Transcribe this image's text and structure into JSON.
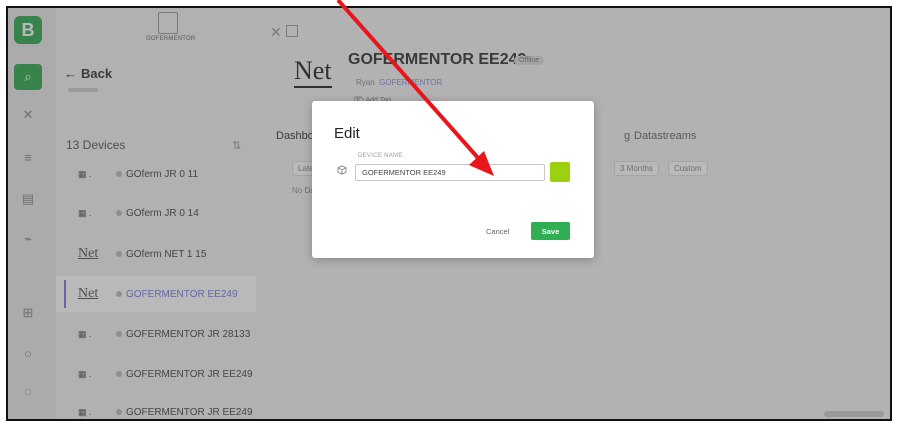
{
  "rail": {
    "logo_letter": "B",
    "accent_color": "#2fa84f"
  },
  "sidebar": {
    "brand_label": "GOFERMENTOR",
    "back_label": "Back",
    "devices_heading": "13 Devices",
    "devices": [
      {
        "thumb": "▦ .",
        "thumb_kind": "board",
        "name": "GOferm JR 0 11"
      },
      {
        "thumb": "▦ .",
        "thumb_kind": "board",
        "name": "GOferm JR 0 14"
      },
      {
        "thumb": "Net",
        "thumb_kind": "net",
        "name": "GOferm NET 1 15"
      },
      {
        "thumb": "Net",
        "thumb_kind": "net",
        "name": "GOFERMENTOR EE249",
        "selected": true
      },
      {
        "thumb": "▦ .",
        "thumb_kind": "board",
        "name": "GOFERMENTOR JR 28133"
      },
      {
        "thumb": "▦ .",
        "thumb_kind": "board",
        "name": "GOFERMENTOR JR EE249"
      },
      {
        "thumb": "▦ .",
        "thumb_kind": "board",
        "name": "GOFERMENTOR JR EE249"
      }
    ]
  },
  "header": {
    "logo_text": "Net",
    "device_title": "GOFERMENTOR EE249",
    "status": "Offline",
    "owner_prefix": "Ryan",
    "owner_org": "GOFERMENTOR",
    "add_tag": "Add Tag"
  },
  "tabs": [
    {
      "label": "Dashbo",
      "active": true
    },
    {
      "label": "g"
    },
    {
      "label": "Datastreams"
    }
  ],
  "filters": [
    {
      "label": "Lates"
    },
    {
      "label": "3 Months"
    },
    {
      "label": "Custom"
    }
  ],
  "no_data": "No Da",
  "modal": {
    "title": "Edit",
    "field_label": "DEVICE NAME",
    "device_name": "GOFERMENTOR EE249",
    "swatch_color": "#9bd10f",
    "cancel_label": "Cancel",
    "save_label": "Save"
  },
  "annotation": {
    "arrow_color": "#e8161b"
  }
}
